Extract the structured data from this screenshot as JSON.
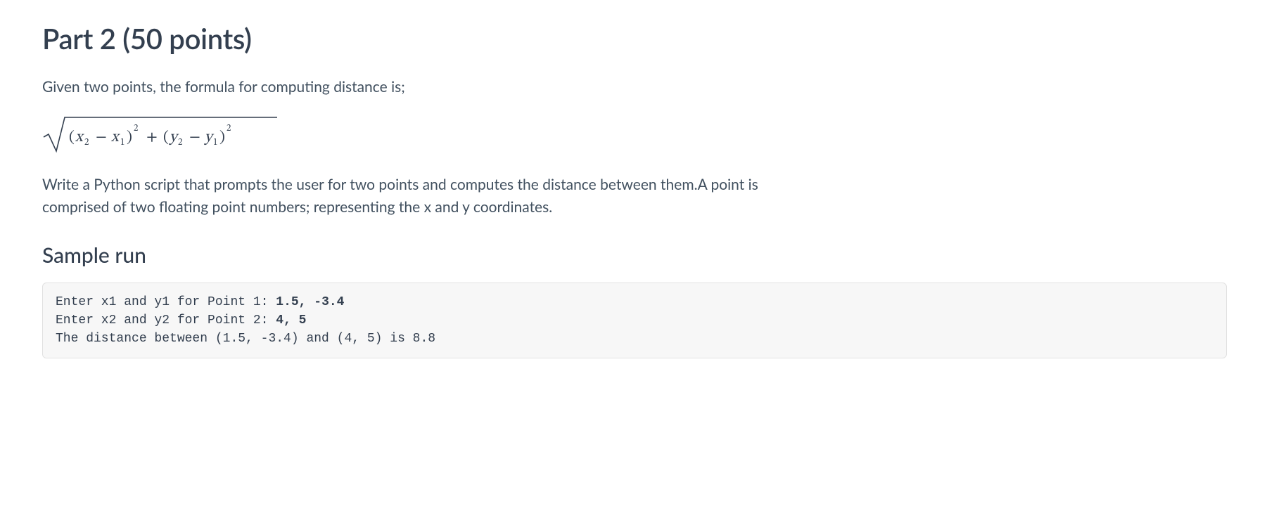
{
  "title": "Part 2 (50 points)",
  "intro": "Given two points, the formula for computing distance is;",
  "formula": {
    "x2": "x",
    "x2sub": "2",
    "x1": "x",
    "x1sub": "1",
    "y2": "y",
    "y2sub": "2",
    "y1": "y",
    "y1sub": "1",
    "minus": "−",
    "plus": "+",
    "exp": "2"
  },
  "instructions": "Write a Python script that prompts the user for two points and computes the distance between them.A point is comprised of two floating point numbers; representing the x and y coordinates.",
  "sample_heading": "Sample run",
  "sample": {
    "line1_prompt": "Enter x1 and y1 for Point 1: ",
    "line1_input": "1.5, -3.4",
    "line2_prompt": "Enter x2 and y2 for Point 2: ",
    "line2_input": "4, 5",
    "line3": "The distance between (1.5, -3.4) and (4, 5) is 8.8"
  }
}
